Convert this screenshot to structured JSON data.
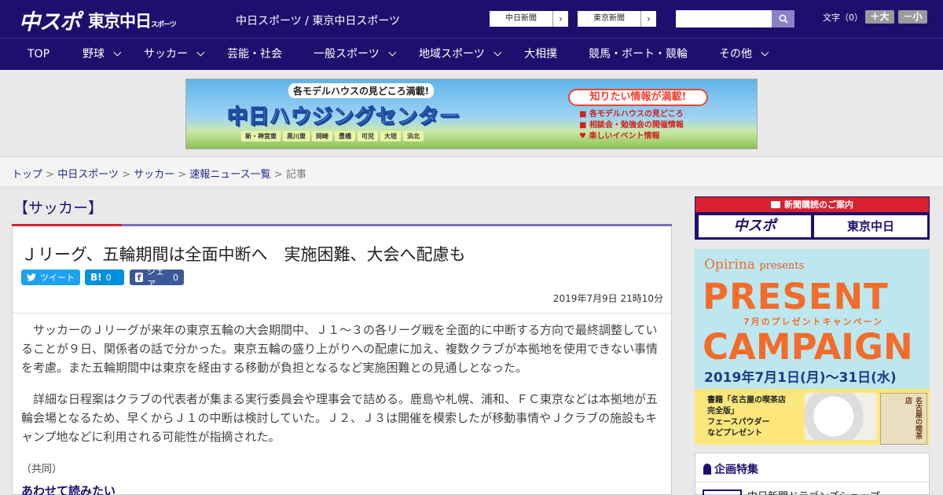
{
  "header": {
    "logo_chuspo": "中スポ",
    "logo_tokyo": "東京中日",
    "logo_tokyo_suffix": "スポーツ",
    "site_names": "中日スポーツ / 東京中日スポーツ",
    "ext_links": [
      {
        "label": "中日新聞"
      },
      {
        "label": "東京新聞"
      }
    ],
    "search": {
      "value": "",
      "icon": "search-icon"
    },
    "font_size_label": "文字（0）",
    "font_plus": "＋大",
    "font_minus": "－小"
  },
  "nav": {
    "items": [
      {
        "label": "TOP"
      },
      {
        "label": "野球"
      },
      {
        "label": "サッカー"
      },
      {
        "label": "芸能・社会"
      },
      {
        "label": "一般スポーツ"
      },
      {
        "label": "地域スポーツ"
      },
      {
        "label": "大相撲"
      },
      {
        "label": "競馬・ボート・競輪"
      },
      {
        "label": "その他"
      }
    ]
  },
  "banner": {
    "top_text": "各モデルハウスの見どころ満載!",
    "main_text": "中日ハウジングセンター",
    "towns": [
      "新・神宮東",
      "黒川東",
      "岡崎",
      "豊橋",
      "可児",
      "大垣",
      "浜北"
    ],
    "right_title": "知りたい情報が満載!",
    "right_list": [
      "各モデルハウスの見どころ",
      "相談会・勉強会の開催情報",
      "楽しいイベント情報"
    ]
  },
  "breadcrumb": {
    "items": [
      "トップ",
      "中日スポーツ",
      "サッカー",
      "速報ニュース一覧"
    ],
    "current": "記事"
  },
  "article": {
    "category": "【サッカー】",
    "headline": "Ｊリーグ、五輪期間は全面中断へ　実施困難、大会へ配慮も",
    "share": {
      "tweet_label": "ツイート",
      "hatena_label": "B!",
      "hatena_count": "0",
      "facebook_label": "シェア",
      "facebook_count": "0"
    },
    "datetime": "2019年7月9日 21時10分",
    "paragraphs": [
      "サッカーのＪリーグが来年の東京五輪の大会期間中、Ｊ１～３の各リーグ戦を全面的に中断する方向で最終調整していることが９日、関係者の話で分かった。東京五輪の盛り上がりへの配慮に加え、複数クラブが本拠地を使用できない事情を考慮。また五輪期間中は東京を経由する移動が負担となるなど実施困難との見通しとなった。",
      "詳細な日程案はクラブの代表者が集まる実行委員会や理事会で詰める。鹿島や札幌、浦和、ＦＣ東京などは本拠地が五輪会場となるため、早くからＪ１の中断は検討していた。Ｊ２、Ｊ３は開催を模索したが移動事情やＪクラブの施設もキャンプ地などに利用される可能性が指摘された。"
    ],
    "credit": "（共同）",
    "read_also": "あわせて読みたい"
  },
  "sidebar": {
    "subscription": {
      "title": "新聞購読のご案内",
      "button_a": "中スポ",
      "button_b": "東京中日"
    },
    "promo": {
      "brand": "Opirina",
      "presents": "presents",
      "line1": "PRESENT",
      "subline": "7月のプレゼントキャンペーン",
      "line2": "CAMPAIGN",
      "dates": "2019年7月1日(月)～31日(水)",
      "details": [
        "書籍「名古屋の喫茶店",
        "完全版」",
        "フェースパウダー",
        "などプレゼント"
      ],
      "book_title": "名古屋の喫茶店"
    },
    "feature": {
      "title": "企画特集",
      "item": "中日新聞ドラゴンズショップ"
    }
  },
  "colors": {
    "brand_navy": "#1e0f6e",
    "accent_red": "#d8202e",
    "twitter": "#1da1f2",
    "hatena": "#008fde",
    "facebook": "#3b5998",
    "promo_orange": "#f36c2a"
  }
}
